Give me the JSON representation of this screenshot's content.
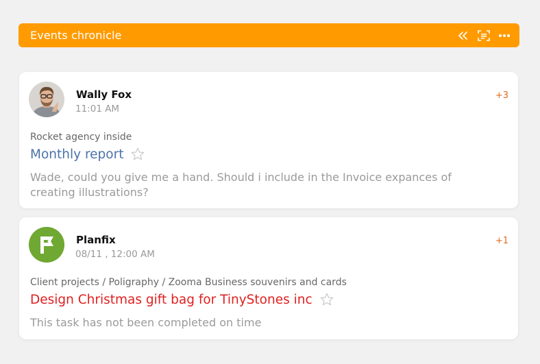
{
  "header": {
    "title": "Events chronicle"
  },
  "events": [
    {
      "author": "Wally Fox",
      "time": "11:01 AM",
      "counter": "+3",
      "project": "Rocket agency inside",
      "task_title": "Monthly report",
      "task_color": "#4a72a8",
      "message": "Wade, could you give me a hand. Should i include in the Invoice expances of creating illustrations?"
    },
    {
      "author": "Planfix",
      "time": "08/11 , 12:00 AM",
      "counter": "+1",
      "project": "Client projects / Poligraphy / Zooma Business souvenirs and cards",
      "task_title": "Design Christmas gift bag for TinyStones inc",
      "task_color": "#e02020",
      "message": "This task has not been completed on time"
    }
  ],
  "colors": {
    "accent": "#ff9b00",
    "planfix_green": "#6fa832"
  }
}
